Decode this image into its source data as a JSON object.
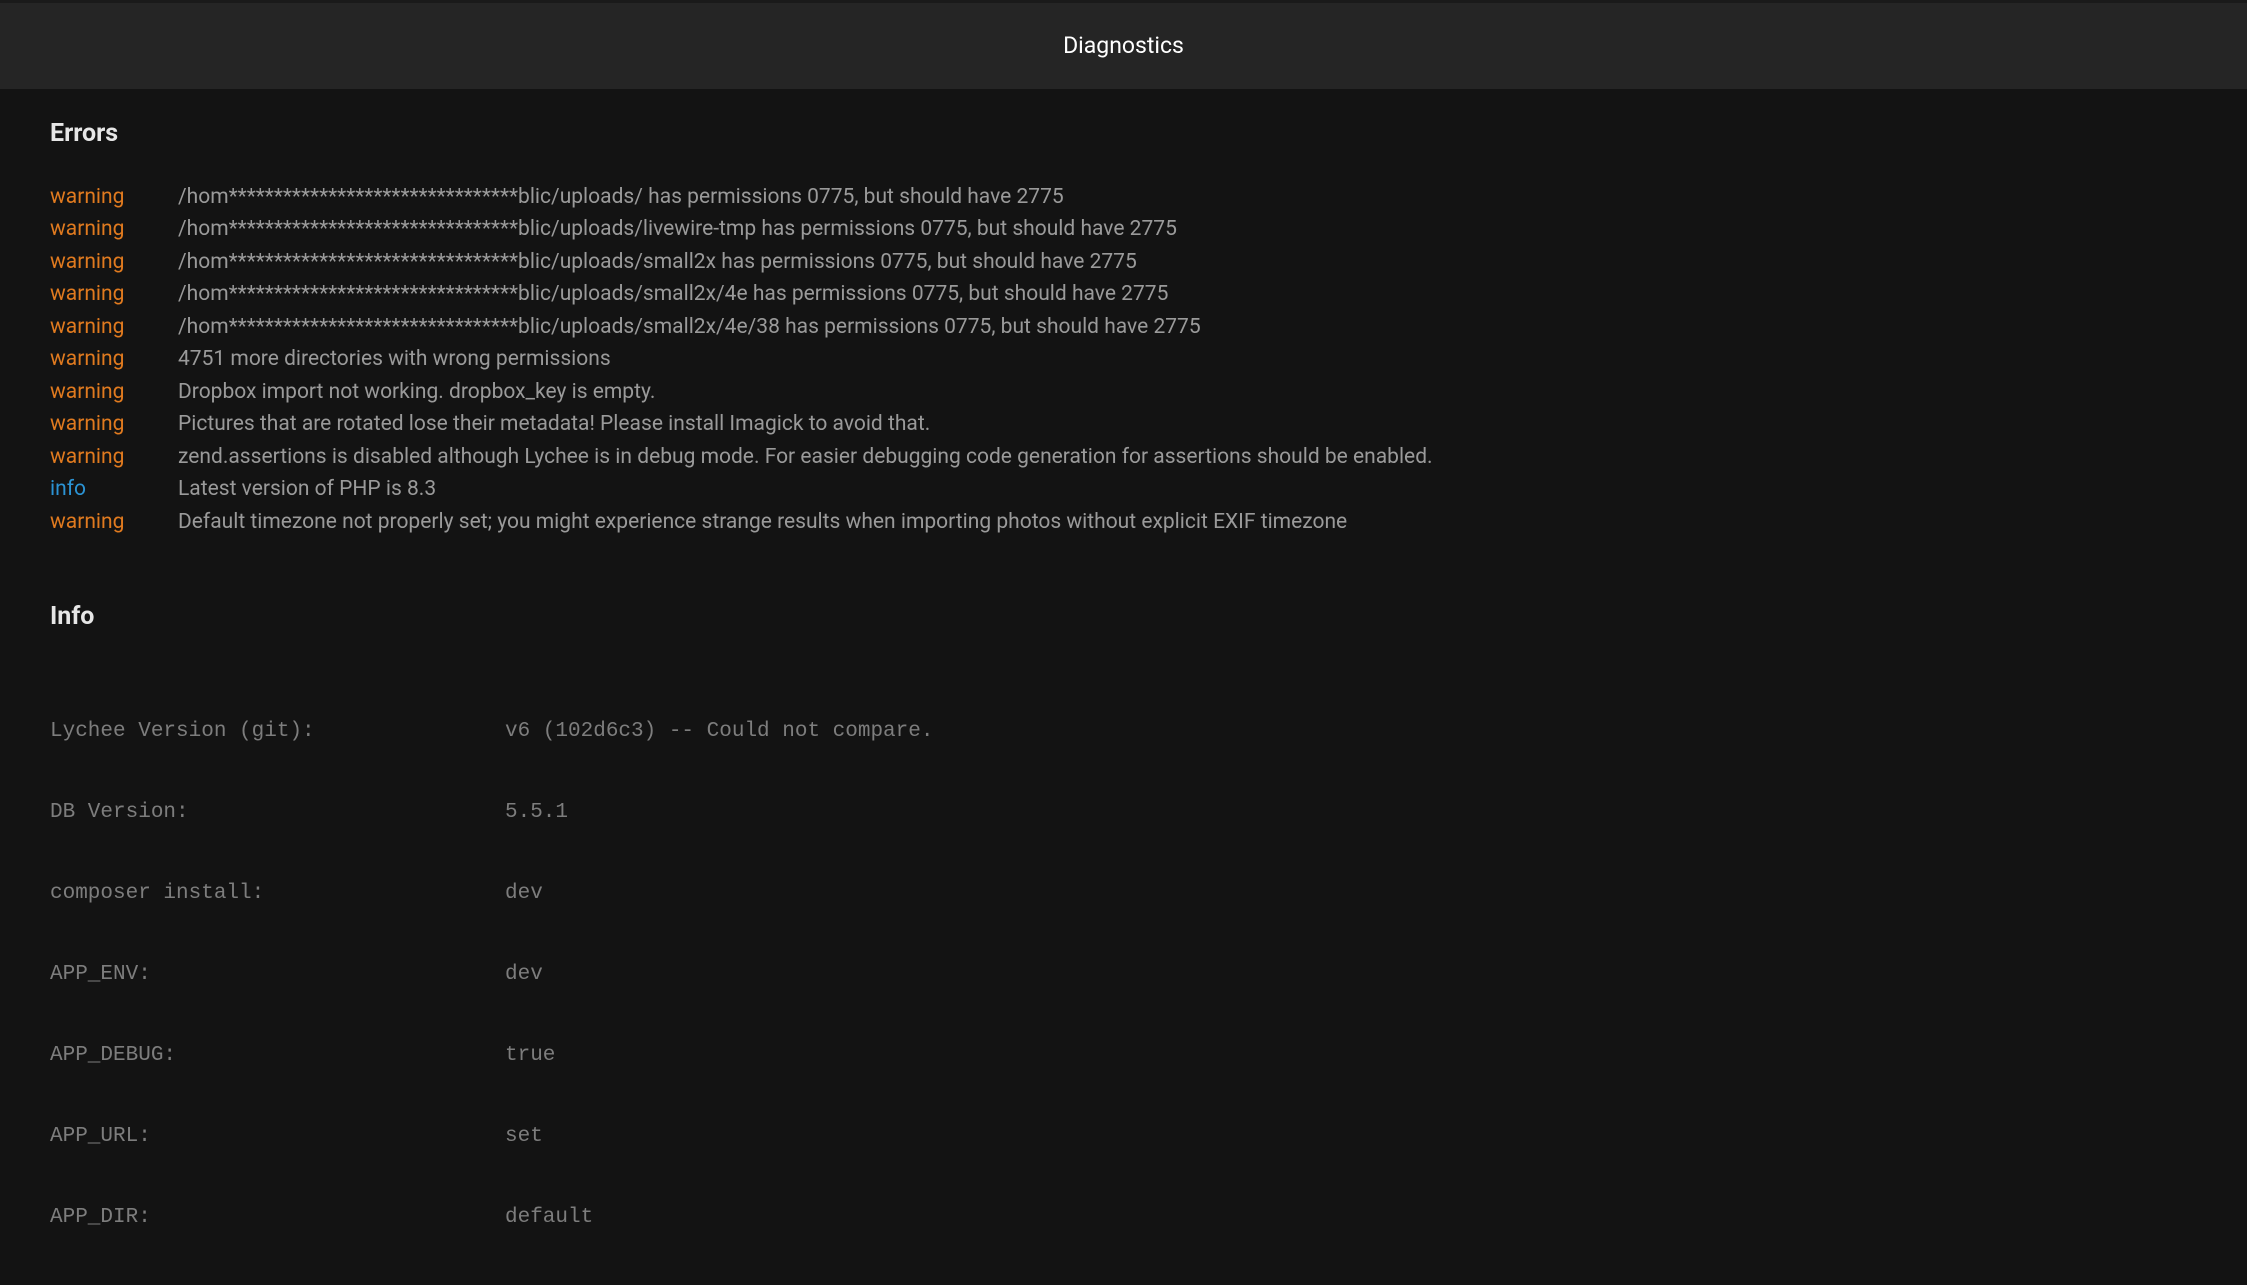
{
  "header": {
    "title": "Diagnostics"
  },
  "sections": {
    "errors_heading": "Errors",
    "info_heading": "Info"
  },
  "errors": [
    {
      "level": "warning",
      "message": "/hom********************************blic/uploads/ has permissions 0775, but should have 2775"
    },
    {
      "level": "warning",
      "message": "/hom********************************blic/uploads/livewire-tmp has permissions 0775, but should have 2775"
    },
    {
      "level": "warning",
      "message": "/hom********************************blic/uploads/small2x has permissions 0775, but should have 2775"
    },
    {
      "level": "warning",
      "message": "/hom********************************blic/uploads/small2x/4e has permissions 0775, but should have 2775"
    },
    {
      "level": "warning",
      "message": "/hom********************************blic/uploads/small2x/4e/38 has permissions 0775, but should have 2775"
    },
    {
      "level": "warning",
      "message": "4751 more directories with wrong permissions"
    },
    {
      "level": "warning",
      "message": "Dropbox import not working. dropbox_key is empty."
    },
    {
      "level": "warning",
      "message": "Pictures that are rotated lose their metadata! Please install Imagick to avoid that."
    },
    {
      "level": "warning",
      "message": "zend.assertions is disabled although Lychee is in debug mode. For easier debugging code generation for assertions should be enabled."
    },
    {
      "level": "info",
      "message": "Latest version of PHP is 8.3"
    },
    {
      "level": "warning",
      "message": "Default timezone not properly set; you might experience strange results when importing photos without explicit EXIF timezone"
    }
  ],
  "info": [
    {
      "key": "Lychee Version (git):",
      "value": "v6 (102d6c3) -- Could not compare."
    },
    {
      "key": "DB Version:",
      "value": "5.5.1"
    },
    {
      "key": "composer install:",
      "value": "dev"
    },
    {
      "key": "APP_ENV:",
      "value": "dev"
    },
    {
      "key": "APP_DEBUG:",
      "value": "true"
    },
    {
      "key": "APP_URL:",
      "value": "set"
    },
    {
      "key": "APP_DIR:",
      "value": "default"
    }
  ]
}
